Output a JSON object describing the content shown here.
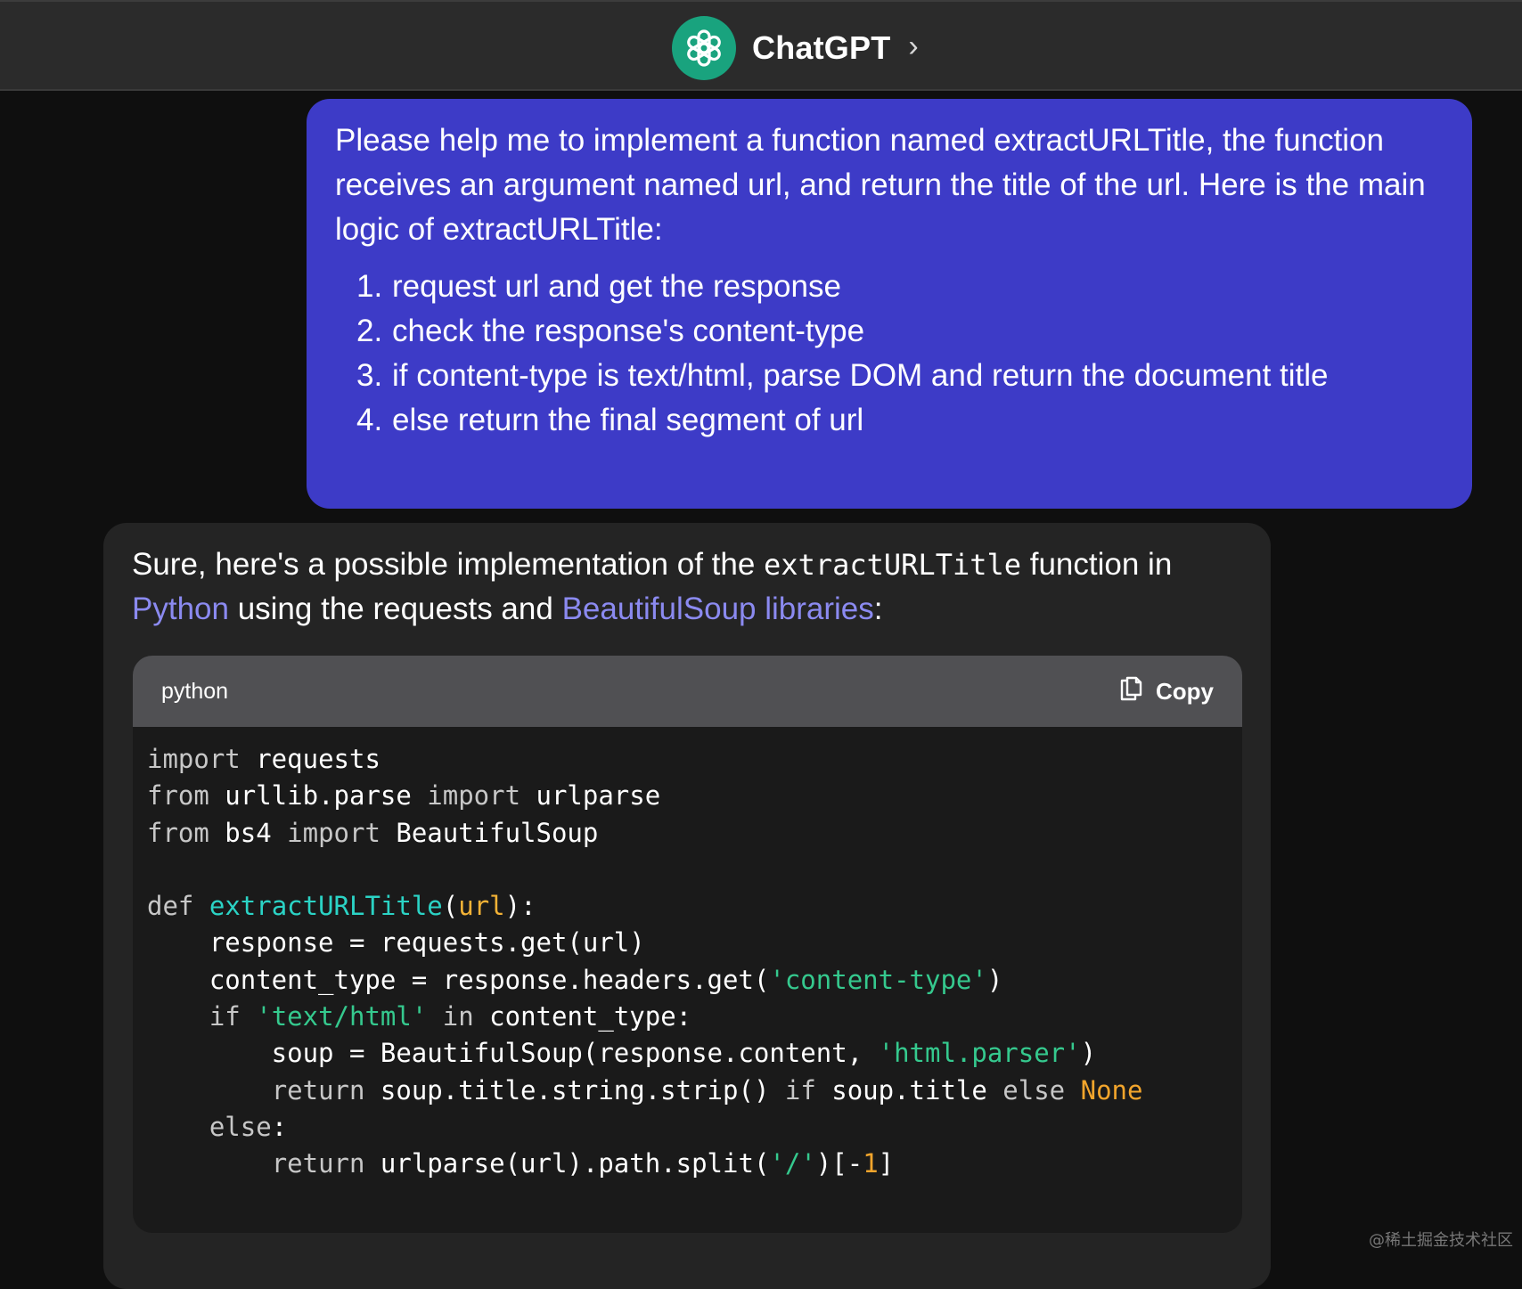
{
  "header": {
    "title": "ChatGPT",
    "chevron": "›",
    "logo_icon": "openai-logo-icon",
    "logo_color": "#19a37e"
  },
  "user_message": {
    "text": "Please help me to implement a function named extractURLTitle, the function receives an argument named url, and return the title of the url. Here is the main logic of extractURLTitle:",
    "steps": [
      {
        "num": "1.",
        "text": "request url and get the response"
      },
      {
        "num": "2.",
        "text": "check the response's content-type"
      },
      {
        "num": "3.",
        "text": "if content-type is text/html, parse DOM and return the document title"
      },
      {
        "num": "4.",
        "text": "else return the final segment of url"
      }
    ],
    "bubble_color": "#3d3bc7"
  },
  "assistant_message": {
    "intro_1": "Sure, here's a possible implementation of the ",
    "intro_code": "extractURLTitle",
    "intro_2": " function in ",
    "link_python": "Python",
    "intro_3": " using the requests and ",
    "link_bs": "BeautifulSoup libraries",
    "intro_4": ":",
    "link_color": "#8b8af0"
  },
  "code_block": {
    "language": "python",
    "copy_label": "Copy",
    "copy_icon": "clipboard-icon",
    "lines": [
      [
        {
          "t": "import",
          "c": "kw"
        },
        {
          "t": " requests",
          "c": ""
        }
      ],
      [
        {
          "t": "from",
          "c": "kw"
        },
        {
          "t": " urllib.parse ",
          "c": ""
        },
        {
          "t": "import",
          "c": "kw"
        },
        {
          "t": " urlparse",
          "c": ""
        }
      ],
      [
        {
          "t": "from",
          "c": "kw"
        },
        {
          "t": " bs4 ",
          "c": ""
        },
        {
          "t": "import",
          "c": "kw"
        },
        {
          "t": " BeautifulSoup",
          "c": ""
        }
      ],
      [],
      [
        {
          "t": "def",
          "c": "kw"
        },
        {
          "t": " ",
          "c": ""
        },
        {
          "t": "extractURLTitle",
          "c": "fn"
        },
        {
          "t": "(",
          "c": ""
        },
        {
          "t": "url",
          "c": "pm"
        },
        {
          "t": "):",
          "c": ""
        }
      ],
      [
        {
          "t": "    response = requests.get(url)",
          "c": ""
        }
      ],
      [
        {
          "t": "    content_type = response.headers.get(",
          "c": ""
        },
        {
          "t": "'content-type'",
          "c": "str"
        },
        {
          "t": ")",
          "c": ""
        }
      ],
      [
        {
          "t": "    ",
          "c": ""
        },
        {
          "t": "if",
          "c": "kw"
        },
        {
          "t": " ",
          "c": ""
        },
        {
          "t": "'text/html'",
          "c": "str"
        },
        {
          "t": " ",
          "c": ""
        },
        {
          "t": "in",
          "c": "kw"
        },
        {
          "t": " content_type:",
          "c": ""
        }
      ],
      [
        {
          "t": "        soup = BeautifulSoup(response.content, ",
          "c": ""
        },
        {
          "t": "'html.parser'",
          "c": "str"
        },
        {
          "t": ")",
          "c": ""
        }
      ],
      [
        {
          "t": "        ",
          "c": ""
        },
        {
          "t": "return",
          "c": "kw"
        },
        {
          "t": " soup.title.string.strip() ",
          "c": ""
        },
        {
          "t": "if",
          "c": "kw"
        },
        {
          "t": " soup.title ",
          "c": ""
        },
        {
          "t": "else",
          "c": "kw"
        },
        {
          "t": " ",
          "c": ""
        },
        {
          "t": "None",
          "c": "nn"
        }
      ],
      [
        {
          "t": "    ",
          "c": ""
        },
        {
          "t": "else",
          "c": "kw"
        },
        {
          "t": ":",
          "c": ""
        }
      ],
      [
        {
          "t": "        ",
          "c": ""
        },
        {
          "t": "return",
          "c": "kw"
        },
        {
          "t": " urlparse(url).path.split(",
          "c": ""
        },
        {
          "t": "'/'",
          "c": "str"
        },
        {
          "t": ")[-",
          "c": ""
        },
        {
          "t": "1",
          "c": "nn"
        },
        {
          "t": "]",
          "c": ""
        }
      ]
    ]
  },
  "watermark": "@稀土掘金技术社区"
}
